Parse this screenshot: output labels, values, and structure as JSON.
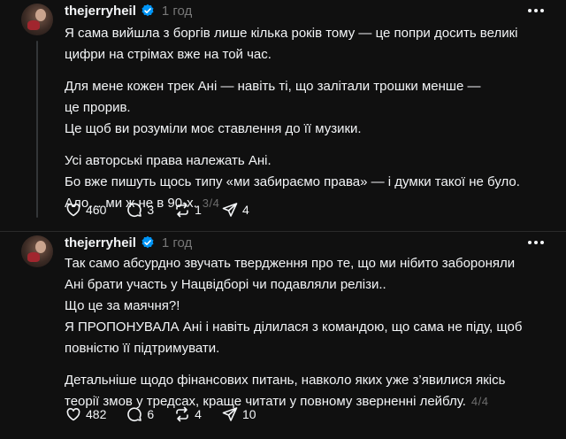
{
  "posts": [
    {
      "username": "thejerryheil",
      "time": "1 год",
      "paragraphs": [
        [
          "Я сама вийшла з боргів лише кілька років тому — це попри досить великі",
          "цифри на стрімах вже на той час."
        ],
        [
          "Для мене кожен трек Ані — навіть ті, що залітали трошки менше —",
          "це прорив.",
          "Це щоб ви розуміли моє ставлення до її музики."
        ],
        [
          "Усі авторські права належать Ані.",
          "Бо вже пишуть щось типу «ми забираємо права» — і думки такої не було.",
          "Ало… ми ж не в 90-х."
        ]
      ],
      "counter": "3/4",
      "likes": "460",
      "replies": "3",
      "reposts": "1",
      "shares": "4"
    },
    {
      "username": "thejerryheil",
      "time": "1 год",
      "paragraphs": [
        [
          "Так само абсурдно звучать твердження про те, що ми нібито забороняли",
          "Ані брати участь у Нацвідборі чи подавляли релізи..",
          "Що це за маячня?!",
          "Я ПРОПОНУВАЛА Ані і навіть ділилася з командою, що сама не піду, щоб",
          "повністю її підтримувати."
        ],
        [
          "Детальніше щодо фінансових питань, навколо яких уже з’явилися якісь",
          "теорії змов у тредсах, краще читати у повному зверненні лейблу."
        ]
      ],
      "counter": "4/4",
      "likes": "482",
      "replies": "6",
      "reposts": "4",
      "shares": "10"
    }
  ],
  "colors": {
    "background": "#101010",
    "text": "#f3f5f7",
    "muted": "#777777",
    "verified": "#0095f6"
  }
}
